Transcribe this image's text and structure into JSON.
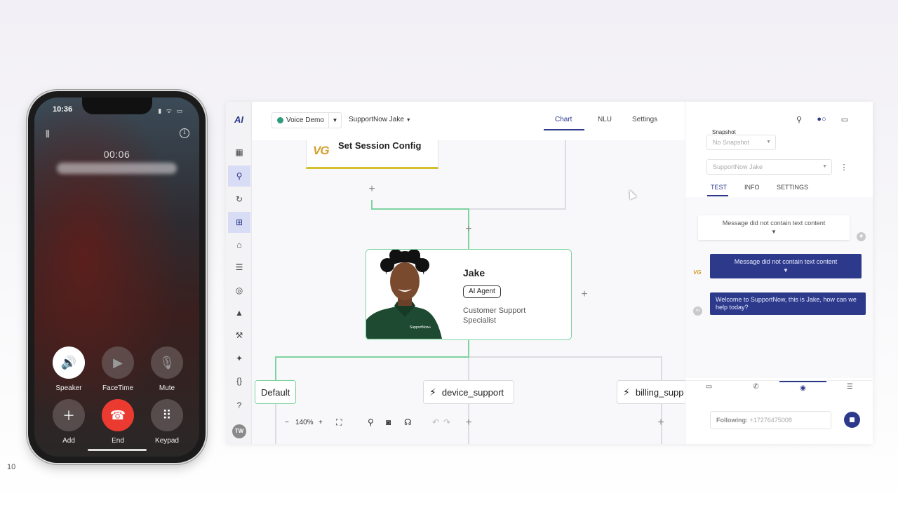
{
  "slide_number": "10",
  "phone": {
    "time": "10:36",
    "status_icons": "▮ ᯤ ▭",
    "call_duration": "00:06",
    "buttons": [
      {
        "label": "Speaker",
        "glyph": "🔊"
      },
      {
        "label": "FaceTime",
        "glyph": "▶"
      },
      {
        "label": "Mute",
        "glyph": "🎙"
      },
      {
        "label": "Add",
        "glyph": "＋"
      },
      {
        "label": "End",
        "glyph": "☎"
      },
      {
        "label": "Keypad",
        "glyph": "⠿"
      }
    ]
  },
  "app": {
    "logo": "AI",
    "user_initials": "TW",
    "flow_selector": "Voice Demo",
    "agent_selector": "SupportNow Jake",
    "tabs": {
      "chart": "Chart",
      "nlu": "NLU",
      "settings": "Settings"
    },
    "canvas": {
      "session_node_logo": "VG",
      "session_node_title": "Set Session Config",
      "agent_name": "Jake",
      "agent_tag": "AI Agent",
      "agent_role": "Customer Support Specialist",
      "badge_text": "SupportNow+",
      "intents": [
        "Default",
        "device_support",
        "billing_supp"
      ],
      "zoom": "140%"
    },
    "side_panel": {
      "snapshot_label": "Snapshot",
      "snapshot_value": "No Snapshot",
      "endpoint_value": "SupportNow Jake",
      "tabs": {
        "test": "TEST",
        "info": "INFO",
        "settings": "SETTINGS"
      },
      "messages": [
        {
          "text": "Message did not contain text content"
        },
        {
          "text": "Message did not contain text content"
        },
        {
          "text": "Welcome to SupportNow, this is Jake, how can we help today?"
        }
      ],
      "bot_avatar": "VG",
      "user_avatar": "AI",
      "following_label": "Following:",
      "following_number": "+17276475008"
    }
  },
  "colors": {
    "accent": "#2d3a8c",
    "connector": "#7dd3a0",
    "end_call": "#eb3b30",
    "vg": "#d4a02e"
  }
}
